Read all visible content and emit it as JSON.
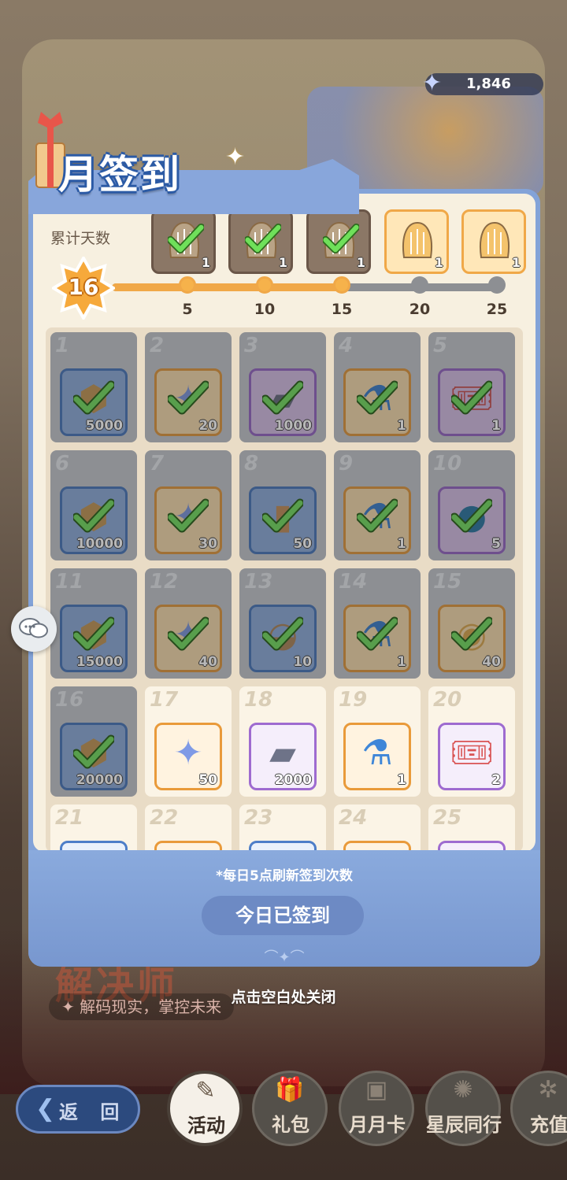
{
  "currency": {
    "value": "1,846",
    "icon": "star-crystal-icon"
  },
  "header": {
    "title": "月签到"
  },
  "cumulative": {
    "label": "累计天数",
    "days": "16",
    "progress_fraction": 0.6,
    "milestones": [
      {
        "day": "5",
        "count": "1",
        "claimed": true
      },
      {
        "day": "10",
        "count": "1",
        "claimed": true
      },
      {
        "day": "15",
        "count": "1",
        "claimed": true
      },
      {
        "day": "20",
        "count": "1",
        "claimed": false
      },
      {
        "day": "25",
        "count": "1",
        "claimed": false
      }
    ]
  },
  "days": [
    {
      "day": "1",
      "qty": "5000",
      "icon": "coin-icon",
      "rarity": "blue",
      "claimed": true
    },
    {
      "day": "2",
      "qty": "20",
      "icon": "star-crystal-icon",
      "rarity": "orange",
      "claimed": true
    },
    {
      "day": "3",
      "qty": "1000",
      "icon": "ingot-icon",
      "rarity": "purple",
      "claimed": true
    },
    {
      "day": "4",
      "qty": "1",
      "icon": "potion-icon",
      "rarity": "orange",
      "claimed": true
    },
    {
      "day": "5",
      "qty": "1",
      "icon": "ticket-icon",
      "rarity": "purple",
      "claimed": true
    },
    {
      "day": "6",
      "qty": "10000",
      "icon": "coin-icon",
      "rarity": "blue",
      "claimed": true
    },
    {
      "day": "7",
      "qty": "30",
      "icon": "star-crystal-icon",
      "rarity": "orange",
      "claimed": true
    },
    {
      "day": "8",
      "qty": "50",
      "icon": "card-icon",
      "rarity": "blue",
      "claimed": true
    },
    {
      "day": "9",
      "qty": "1",
      "icon": "potion-icon",
      "rarity": "orange",
      "claimed": true
    },
    {
      "day": "10",
      "qty": "5",
      "icon": "slime-icon",
      "rarity": "purple",
      "claimed": true
    },
    {
      "day": "11",
      "qty": "15000",
      "icon": "coin-icon",
      "rarity": "blue",
      "claimed": true
    },
    {
      "day": "12",
      "qty": "40",
      "icon": "star-crystal-icon",
      "rarity": "orange",
      "claimed": true
    },
    {
      "day": "13",
      "qty": "10",
      "icon": "bag-icon",
      "rarity": "blue",
      "claimed": true
    },
    {
      "day": "14",
      "qty": "1",
      "icon": "potion-icon",
      "rarity": "orange",
      "claimed": true
    },
    {
      "day": "15",
      "qty": "40",
      "icon": "plate-icon",
      "rarity": "orange",
      "claimed": true
    },
    {
      "day": "16",
      "qty": "20000",
      "icon": "coin-icon",
      "rarity": "blue",
      "claimed": true
    },
    {
      "day": "17",
      "qty": "50",
      "icon": "star-crystal-icon",
      "rarity": "orange",
      "claimed": false
    },
    {
      "day": "18",
      "qty": "2000",
      "icon": "ingot-icon",
      "rarity": "purple",
      "claimed": false
    },
    {
      "day": "19",
      "qty": "1",
      "icon": "potion-icon",
      "rarity": "orange",
      "claimed": false
    },
    {
      "day": "20",
      "qty": "2",
      "icon": "ticket-icon",
      "rarity": "purple",
      "claimed": false
    },
    {
      "day": "21",
      "qty": "",
      "icon": "coin-icon",
      "rarity": "blue",
      "claimed": false
    },
    {
      "day": "22",
      "qty": "",
      "icon": "star-crystal-icon",
      "rarity": "orange",
      "claimed": false
    },
    {
      "day": "23",
      "qty": "",
      "icon": "card-icon",
      "rarity": "blue",
      "claimed": false
    },
    {
      "day": "24",
      "qty": "",
      "icon": "potion-icon",
      "rarity": "orange",
      "claimed": false
    },
    {
      "day": "25",
      "qty": "",
      "icon": "ticket-icon",
      "rarity": "purple",
      "claimed": false
    }
  ],
  "footer": {
    "refresh_note": "*每日5点刷新签到次数",
    "signed_button": "今日已签到"
  },
  "close_hint": "点击空白处关闭",
  "background": {
    "banner_title": "解决师",
    "banner_subtitle": "解码现实，掌控未来"
  },
  "nav": {
    "back": "返 回",
    "items": [
      {
        "label": "活动",
        "active": true
      },
      {
        "label": "礼包",
        "active": false
      },
      {
        "label": "月月卡",
        "active": false
      },
      {
        "label": "星辰同行",
        "active": false
      },
      {
        "label": "充值",
        "active": false
      }
    ]
  }
}
